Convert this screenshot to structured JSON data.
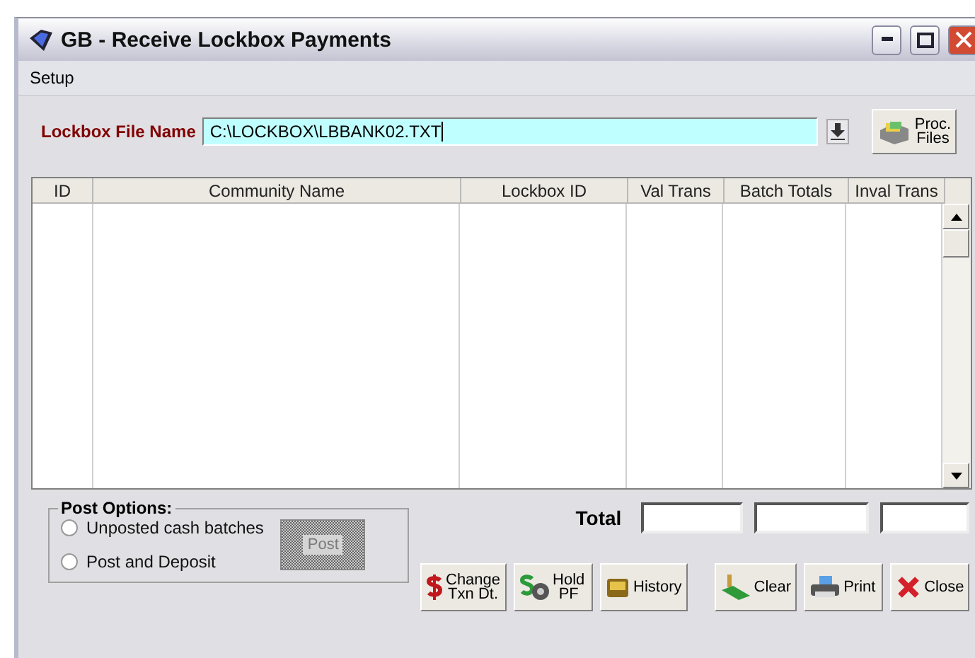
{
  "window": {
    "title": "GB - Receive Lockbox Payments"
  },
  "menu": [
    "Setup"
  ],
  "file": {
    "label": "Lockbox File Name",
    "value": "C:\\LOCKBOX\\LBBANK02.TXT"
  },
  "proc_button": {
    "lines": [
      "Proc.",
      "Files"
    ]
  },
  "table": {
    "columns": [
      "ID",
      "Community Name",
      "Lockbox ID",
      "Val Trans",
      "Batch Totals",
      "Inval Trans"
    ]
  },
  "post_options": {
    "title": "Post Options:",
    "options": [
      {
        "label": "Unposted cash batches",
        "selected": false
      },
      {
        "label": "Post and Deposit",
        "selected": false
      }
    ],
    "post_button": {
      "label": "Post",
      "disabled": true
    }
  },
  "total": {
    "label": "Total"
  },
  "buttons": [
    {
      "kind": "change",
      "lines": [
        "Change",
        "Txn Dt."
      ]
    },
    {
      "kind": "hold",
      "lines": [
        "Hold",
        "PF"
      ]
    },
    {
      "kind": "history",
      "lines": [
        "History"
      ]
    },
    {
      "kind": "clear",
      "lines": [
        "Clear"
      ]
    },
    {
      "kind": "print",
      "lines": [
        "Print"
      ]
    },
    {
      "kind": "close",
      "lines": [
        "Close"
      ]
    }
  ]
}
